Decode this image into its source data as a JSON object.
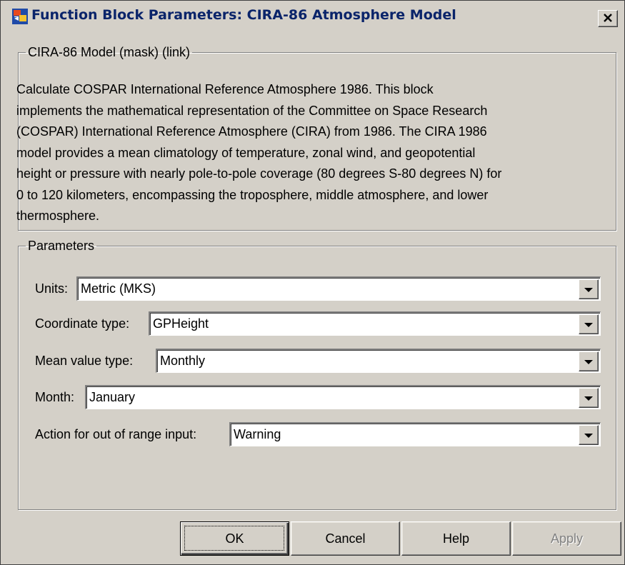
{
  "window": {
    "title": "Function Block Parameters: CIRA-86 Atmosphere Model"
  },
  "description_group": {
    "legend": "CIRA-86 Model (mask) (link)",
    "lines": [
      "Calculate COSPAR International Reference Atmosphere 1986. This block",
      "implements the mathematical representation of the Committee on Space Research",
      "(COSPAR) International Reference Atmosphere (CIRA) from 1986. The CIRA 1986",
      "model provides a mean climatology of temperature, zonal wind, and geopotential",
      "height or pressure with nearly pole-to-pole coverage (80 degrees S-80 degrees N) for",
      "0 to 120 kilometers, encompassing the troposphere, middle atmosphere, and lower",
      "thermosphere."
    ]
  },
  "parameters": {
    "legend": "Parameters",
    "units": {
      "label": "Units:",
      "value": "Metric (MKS)"
    },
    "coordinate_type": {
      "label": "Coordinate type:",
      "value": "GPHeight"
    },
    "mean_value_type": {
      "label": "Mean value type:",
      "value": "Monthly"
    },
    "month": {
      "label": "Month:",
      "value": "January"
    },
    "action_out_of_range": {
      "label": "Action for out of range input:",
      "value": "Warning"
    }
  },
  "buttons": {
    "ok": "OK",
    "cancel": "Cancel",
    "help": "Help",
    "apply": "Apply"
  },
  "colors": {
    "dialog_bg": "#d4d0c8",
    "title_text": "#0a246a",
    "disabled_text": "#808080"
  }
}
